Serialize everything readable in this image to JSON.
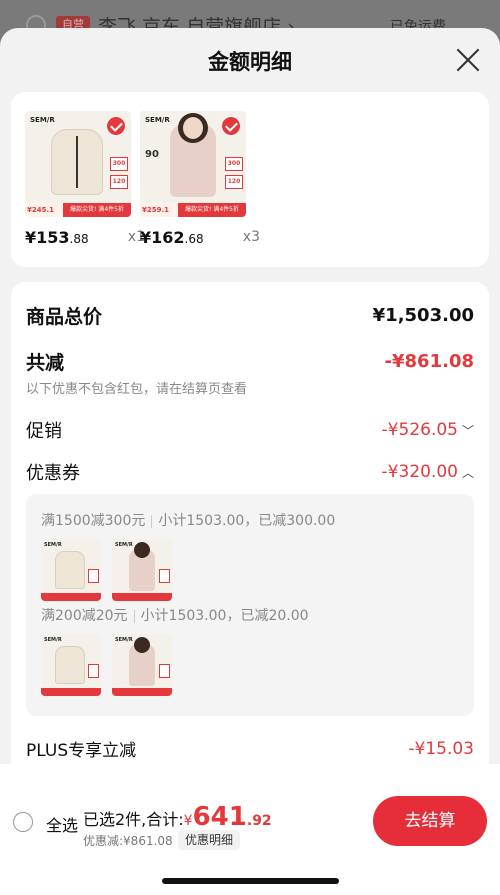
{
  "background": {
    "badge": "自营",
    "store_name": "李飞 京东 自营旗舰店 ›",
    "right_text": "已免运费"
  },
  "sheet": {
    "title": "金额明细"
  },
  "products": [
    {
      "brand": "SEM/R",
      "thumb_price": "¥245.1",
      "thumb_promo": "爆款尖货! 满4件5折",
      "side_tag_top": "300",
      "side_tag_bottom": "120",
      "price_main": "¥153",
      "price_dec": ".88",
      "qty": "x1",
      "selected": true
    },
    {
      "brand": "SEM/R",
      "thumb_price": "¥259.1",
      "thumb_promo": "爆款尖货! 满4件5折",
      "side_tag_top": "300",
      "side_tag_bottom": "120",
      "badge": "90",
      "price_main": "¥162",
      "price_dec": ".68",
      "qty": "x3",
      "selected": true
    }
  ],
  "details": {
    "total_label": "商品总价",
    "total_amount": "¥1,503.00",
    "reduce_label": "共减",
    "reduce_amount": "-¥861.08",
    "note": "以下优惠不包含红包，请在结算页查看",
    "promo_label": "促销",
    "promo_amount": "-¥526.05",
    "coupon_label": "优惠券",
    "coupon_amount": "-¥320.00",
    "coupons": [
      {
        "rule": "满1500减300元",
        "subtotal": "小计1503.00，已减300.00"
      },
      {
        "rule": "满200减20元",
        "subtotal": "小计1503.00，已减20.00"
      }
    ],
    "plus_label": "PLUS专享立减",
    "plus_amount": "-¥15.03"
  },
  "bottom": {
    "select_all": "全选",
    "selected_text": "已选2件,合计:",
    "yen": "¥",
    "total_main": "641",
    "total_dec": ".92",
    "discount": "优惠减:¥861.08",
    "detail_pill": "优惠明细",
    "checkout": "去结算"
  },
  "colors": {
    "accent": "#e4393c",
    "checkout_bg": "#e52e3a",
    "sheet_bg": "#f2f2f2"
  },
  "icons": [
    "close-icon",
    "check-icon",
    "chevron-down-icon",
    "chevron-up-icon"
  ]
}
